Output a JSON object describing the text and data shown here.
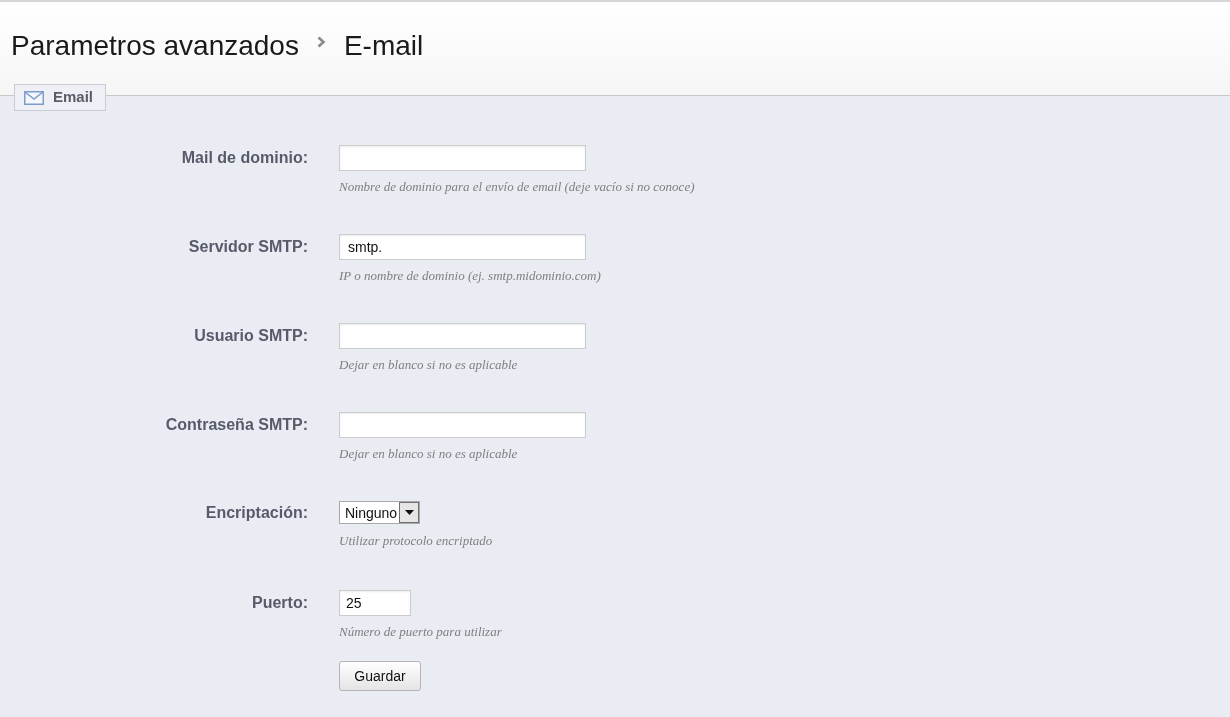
{
  "breadcrumb": {
    "parent": "Parametros avanzados",
    "current": "E-mail"
  },
  "tab": {
    "label": "Email"
  },
  "fields": [
    {
      "kind": "text",
      "label": "Mail de dominio:",
      "hint": "Nombre de dominio para el envío de email (deje vacío si no conoce)"
    },
    {
      "kind": "text",
      "label": "Servidor SMTP:",
      "value": "smtp.",
      "hint": "IP o nombre de dominio (ej. smtp.midominio.com)"
    },
    {
      "kind": "text",
      "label": "Usuario SMTP:",
      "hint": "Dejar en blanco si no es aplicable"
    },
    {
      "kind": "text",
      "label": "Contraseña SMTP:",
      "hint": "Dejar en blanco si no es aplicable"
    },
    {
      "kind": "select",
      "label": "Encriptación:",
      "value": "Ninguno",
      "hint": "Utilizar protocolo encriptado"
    },
    {
      "kind": "number",
      "label": "Puerto:",
      "value": "25",
      "hint": "Número de puerto para utilizar"
    }
  ],
  "save_button": "Guardar"
}
